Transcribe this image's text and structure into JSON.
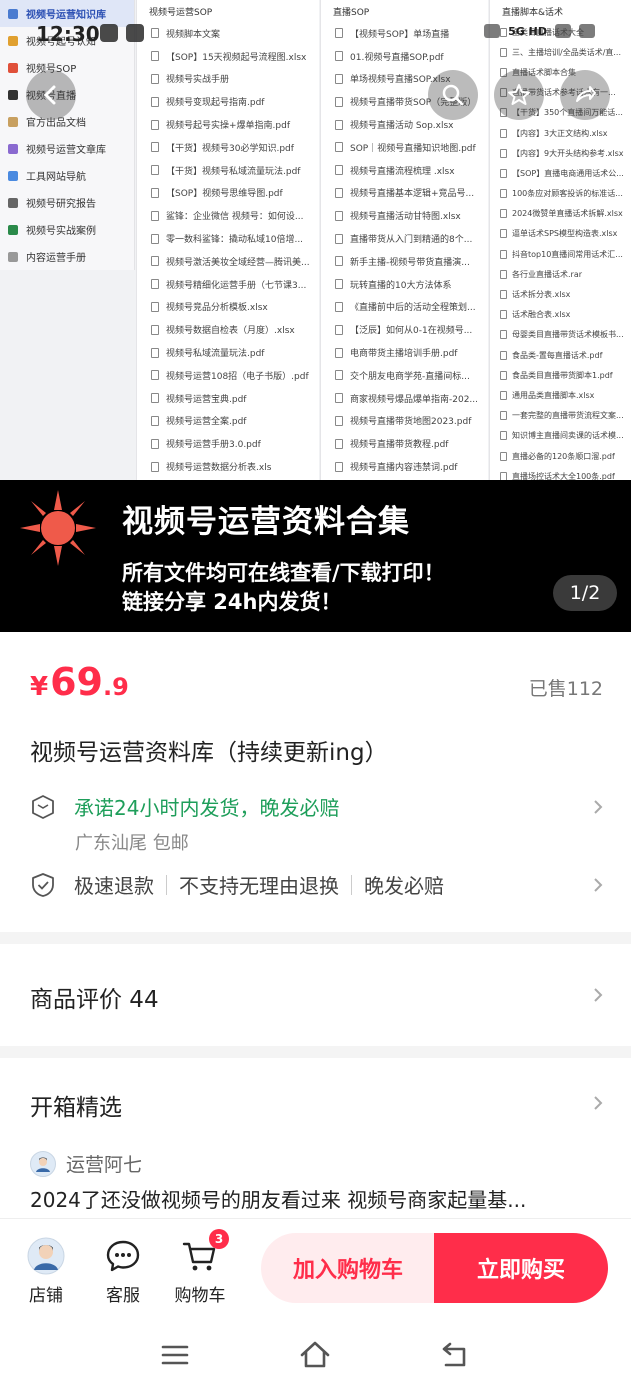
{
  "status_bar": {
    "time": "12:30",
    "network": "5G HD"
  },
  "hero": {
    "sidebar": [
      {
        "label": "视频号运营知识库",
        "color": "#4a7bd0",
        "active": true
      },
      {
        "label": "视频号起号认知",
        "color": "#e0a030"
      },
      {
        "label": "视频号SOP",
        "color": "#e0503a"
      },
      {
        "label": "视频号直播",
        "color": "#333333"
      },
      {
        "label": "官方出品文档",
        "color": "#c8a060"
      },
      {
        "label": "视频号运营文章库",
        "color": "#8a6ad0"
      },
      {
        "label": "工具网站导航",
        "color": "#4a8ae0"
      },
      {
        "label": "视频号研究报告",
        "color": "#666666"
      },
      {
        "label": "视频号实战案例",
        "color": "#2a8a4a"
      },
      {
        "label": "内容运营手册",
        "color": "#999999"
      }
    ],
    "col1": {
      "head": "视频号运营SOP",
      "files": [
        "视频脚本文案",
        "【SOP】15天视频起号流程图.xlsx",
        "视频号实战手册",
        "视频号变现起号指南.pdf",
        "视频号起号实操+爆单指南.pdf",
        "【干货】视频号30必学知识.pdf",
        "【干货】视频号私域流量玩法.pdf",
        "【SOP】视频号思维导图.pdf",
        "鲨锋：企业微信 视频号：如何设...",
        "零一数科鲨锋：撬动私域10倍增...",
        "视频号激活美妆全域经营—腾讯美...",
        "视频号精细化运营手册（七节课3...",
        "视频号竞品分析模板.xlsx",
        "视频号数据自检表（月度）.xlsx",
        "视频号私域流量玩法.pdf",
        "视频号运营108招（电子书版）.pdf",
        "视频号运营宝典.pdf",
        "视频号运营全案.pdf",
        "视频号运营手册3.0.pdf",
        "视频号运营数据分析表.xls"
      ]
    },
    "col2": {
      "head": "直播SOP",
      "files": [
        "【视频号SOP】单场直播",
        "01.视频号直播SOP.pdf",
        "单场视频号直播SOP.xlsx",
        "视频号直播带货SOP（完整版）",
        "视频号直播活动 Sop.xlsx",
        "SOP｜视频号直播知识地图.pdf",
        "视频号直播流程梳理 .xlsx",
        "视频号直播基本逻辑+竞品号...",
        "视频号直播活动甘特图.xlsx",
        "直播带货从入门到精通的8个...",
        "新手主播-视频号带货直播演...",
        "玩转直播的10大方法体系",
        "《直播前中后的活动全程策划...",
        "【泛辰】如何从0-1在视频号...",
        "电商带货主播培训手册.pdf",
        "交个朋友电商学苑-直播间标...",
        "商家视频号爆品爆单指南-202...",
        "视频号直播带货地图2023.pdf",
        "视频号直播带货教程.pdf",
        "视频号直播内容违禁词.pdf"
      ]
    },
    "col3": {
      "head": "直播脚本&话术",
      "files": [
        "全类目直播话术大全",
        "三、主播培训/全品类话术/直...",
        "直播话术脚本合集",
        "直播带货话术参考话术有一...",
        "【干货】350个直播间万能话...",
        "【内容】3大正文结构.xlsx",
        "【内容】9大开头结构参考.xlsx",
        "【SOP】直播电商通用话术公...",
        "100条应对顾客投诉的标准话...",
        "2024微赞单直播话术拆解.xlsx",
        "逼单话术SPS模型构造表.xlsx",
        "抖音top10直播间常用话术汇...",
        "各行业直播话术.rar",
        "话术拆分表.xlsx",
        "话术融合表.xlsx",
        "母婴类目直播带货话术模板书...",
        "食品类-置每直播话术.pdf",
        "食品类目直播带货脚本1.pdf",
        "通用品类直播脚本.xlsx",
        "一套完整的直播带货流程文案...",
        "知识博主直播间卖课的话术模...",
        "直播必备的120条顺口溜.pdf",
        "直播场控话术大全100条.pdf"
      ]
    }
  },
  "banner": {
    "title": "视频号运营资料合集",
    "line1": "所有文件均可在线查看/下载打印！",
    "line2": "链接分享 24h内发货！",
    "page_indicator": "1/2"
  },
  "product": {
    "currency": "¥",
    "price_int": "69",
    "price_dec": ".9",
    "sold": "已售112",
    "title": "视频号运营资料库（持续更新ing）",
    "promise": "承诺24小时内发货，晚发必赔",
    "ship_from": "广东汕尾 包邮",
    "guarantees": [
      "极速退款",
      "不支持无理由退换",
      "晚发必赔"
    ]
  },
  "reviews": {
    "label": "商品评价 44"
  },
  "unboxing": {
    "label": "开箱精选",
    "user": "运营阿七",
    "text": "2024了还没做视频号的朋友看过来 视频号商家起量基..."
  },
  "actions": {
    "shop": "店铺",
    "service": "客服",
    "cart": "购物车",
    "cart_count": "3",
    "add_to_cart": "加入购物车",
    "buy_now": "立即购买"
  },
  "colors": {
    "accent": "#ff2d4a",
    "promise_green": "#1e9e5a",
    "banner_bg": "#000000"
  }
}
